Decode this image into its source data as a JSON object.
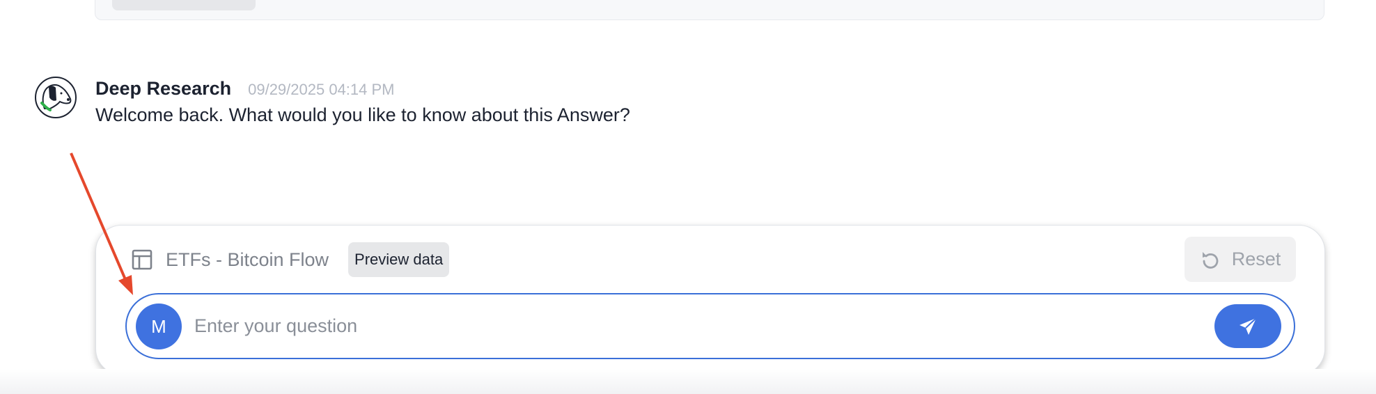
{
  "message": {
    "author": "Deep Research",
    "timestamp": "09/29/2025 04:14 PM",
    "text": "Welcome back. What would you like to know about this Answer?",
    "avatar_icon": "dog-logo-icon"
  },
  "composer": {
    "context_icon": "table-icon",
    "context_label": "ETFs - Bitcoin Flow",
    "preview_label": "Preview data",
    "reset_label": "Reset",
    "reset_icon": "refresh-icon",
    "user_initial": "M",
    "input_placeholder": "Enter your question",
    "input_value": "",
    "send_icon": "paper-plane-icon"
  },
  "annotation": {
    "arrow_color": "#e5482c"
  },
  "colors": {
    "accent": "#3f72e0",
    "text": "#1c2230",
    "muted": "#b3b8c2"
  }
}
